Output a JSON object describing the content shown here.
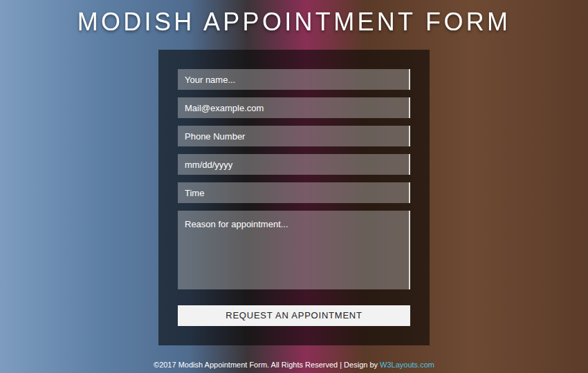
{
  "page": {
    "title": "MODISH APPOINTMENT FORM"
  },
  "form": {
    "fields": [
      {
        "kind": "input",
        "placeholder": "Your name..."
      },
      {
        "kind": "input",
        "placeholder": "Mail@example.com"
      },
      {
        "kind": "input",
        "placeholder": "Phone Number"
      },
      {
        "kind": "input",
        "placeholder": "mm/dd/yyyy"
      },
      {
        "kind": "input",
        "placeholder": "Time"
      },
      {
        "kind": "textarea",
        "placeholder": "Reason for appointment..."
      }
    ],
    "button": "REQUEST AN APPOINTMENT"
  },
  "footer": {
    "text": "©2017 Modish Appointment Form. All Rights Reserved | Design by ",
    "link": "W3Layouts.com"
  }
}
